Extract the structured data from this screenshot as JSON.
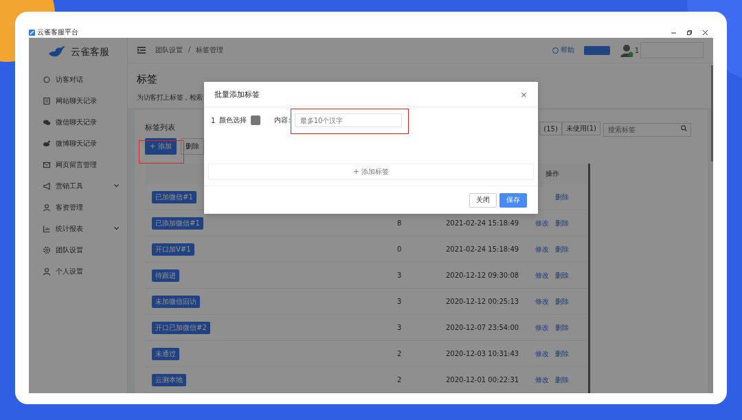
{
  "window": {
    "title": "云雀客服平台"
  },
  "sidebar": {
    "logo": "云雀客服",
    "items": [
      {
        "label": "访客对话",
        "has_submenu": false
      },
      {
        "label": "网站聊天记录",
        "has_submenu": false
      },
      {
        "label": "微信聊天记录",
        "has_submenu": false
      },
      {
        "label": "微博聊天记录",
        "has_submenu": false
      },
      {
        "label": "网页留言管理",
        "has_submenu": false
      },
      {
        "label": "营销工具",
        "has_submenu": true
      },
      {
        "label": "客资管理",
        "has_submenu": false
      },
      {
        "label": "统计报表",
        "has_submenu": true
      },
      {
        "label": "团队设置",
        "has_submenu": false
      },
      {
        "label": "个人设置",
        "has_submenu": false
      }
    ]
  },
  "header": {
    "breadcrumb": [
      "团队设置",
      "标签管理"
    ],
    "separator": "/",
    "help": "帮助",
    "user": "1"
  },
  "page": {
    "title": "标签",
    "description": "为访客打上标签，检索"
  },
  "card": {
    "title": "标签列表",
    "add_button": "+ 添加",
    "delete_button": "删除",
    "filters": [
      {
        "label": "(15)",
        "selected": false
      },
      {
        "label": "未使用(1)",
        "selected": false
      }
    ],
    "search": {
      "placeholder": "搜索标签"
    },
    "table": {
      "action_header": "操作",
      "rows": [
        {
          "tag": "已加微信#1",
          "actions": [
            "删除"
          ]
        },
        {
          "tag": "已添加微信#1",
          "count": "8",
          "date": "2021-02-24 15:18:49",
          "actions": [
            "修改",
            "删除"
          ]
        },
        {
          "tag": "开口加V#1",
          "count": "0",
          "date": "2021-02-24 15:18:49",
          "actions": [
            "修改",
            "删除"
          ]
        },
        {
          "tag": "待跟进",
          "count": "3",
          "date": "2020-12-12 09:30:08",
          "actions": [
            "修改",
            "删除"
          ]
        },
        {
          "tag": "未加微信回访",
          "count": "3",
          "date": "2020-12-12 00:25:13",
          "actions": [
            "修改",
            "删除"
          ]
        },
        {
          "tag": "开口已加微信#2",
          "count": "3",
          "date": "2020-12-07 23:54:00",
          "actions": [
            "修改",
            "删除"
          ]
        },
        {
          "tag": "未通过",
          "count": "2",
          "date": "2020-12-03 10:31:43",
          "actions": [
            "修改",
            "删除"
          ]
        },
        {
          "tag": "云测本地",
          "count": "2",
          "date": "2020-12-01 00:22:31",
          "actions": [
            "修改",
            "删除"
          ]
        }
      ]
    }
  },
  "dialog": {
    "title": "批量添加标签",
    "close": "×",
    "rows": [
      {
        "index": "1",
        "color_label": "颜色选择",
        "content_label": "内容:",
        "placeholder": "最多10个汉字"
      }
    ],
    "add_tag": "+ 添加标签",
    "buttons": [
      {
        "label": "关闭",
        "kind": "secondary"
      },
      {
        "label": "保存",
        "kind": "primary"
      }
    ]
  }
}
